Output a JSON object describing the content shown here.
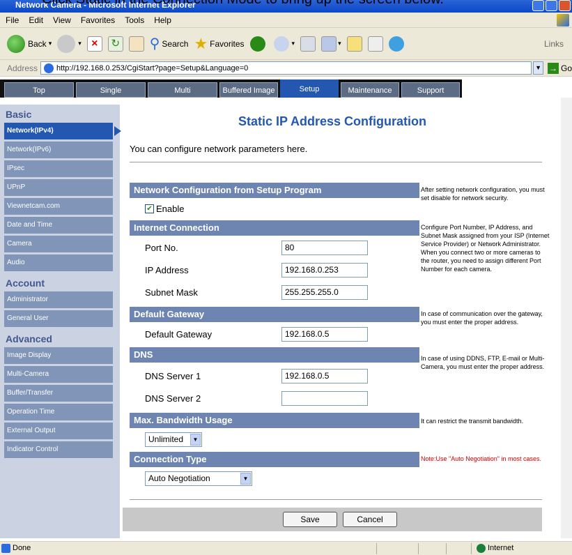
{
  "window": {
    "cut_text": "Click Static in the Connection Mode to bring up the screen below.",
    "title": "Network Camera - Microsoft Internet Explorer"
  },
  "menubar": [
    "File",
    "Edit",
    "View",
    "Favorites",
    "Tools",
    "Help"
  ],
  "toolbar": {
    "back": "Back",
    "search": "Search",
    "favorites": "Favorites",
    "links": "Links"
  },
  "address": {
    "label": "Address",
    "url": "http://192.168.0.253/CgiStart?page=Setup&Language=0",
    "go": "Go"
  },
  "topnav": [
    "Top",
    "Single",
    "Multi",
    "Buffered Image",
    "Setup",
    "Maintenance",
    "Support"
  ],
  "sidebar": {
    "basic_heading": "Basic",
    "basic_items": [
      "Network(IPv4)",
      "Network(IPv6)",
      "IPsec",
      "UPnP",
      "Viewnetcam.com",
      "Date and Time",
      "Camera",
      "Audio"
    ],
    "account_heading": "Account",
    "account_items": [
      "Administrator",
      "General User"
    ],
    "advanced_heading": "Advanced",
    "advanced_items": [
      "Image Display",
      "Multi-Camera",
      "Buffer/Transfer",
      "Operation Time",
      "External Output",
      "Indicator Control"
    ]
  },
  "main": {
    "title": "Static IP Address Configuration",
    "intro": "You can configure network parameters here.",
    "sections": {
      "setup_program": {
        "header": "Network Configuration from Setup Program",
        "enable_label": "Enable",
        "note": "After setting network configuration, you must set disable for network security."
      },
      "internet": {
        "header": "Internet Connection",
        "port_label": "Port No.",
        "port_value": "80",
        "ip_label": "IP Address",
        "ip_value": "192.168.0.253",
        "mask_label": "Subnet Mask",
        "mask_value": "255.255.255.0",
        "note": "Configure Port Number, IP Address, and Subnet Mask assigned from your ISP (Internet Service Provider) or Network Administrator. When you connect two or more cameras to the router, you need to assign different Port Number for each camera."
      },
      "gateway": {
        "header": "Default Gateway",
        "label": "Default Gateway",
        "value": "192.168.0.5",
        "note": "In case of communication over the gateway, you must enter the proper address."
      },
      "dns": {
        "header": "DNS",
        "dns1_label": "DNS Server 1",
        "dns1_value": "192.168.0.5",
        "dns2_label": "DNS Server 2",
        "dns2_value": "",
        "note": "In case of using DDNS, FTP, E-mail or Multi-Camera, you must enter the proper address."
      },
      "bandwidth": {
        "header": "Max. Bandwidth Usage",
        "value": "Unlimited",
        "note": "It can restrict the transmit bandwidth."
      },
      "connection": {
        "header": "Connection Type",
        "value": "Auto Negotiation",
        "note": "Note:Use \"Auto Negotiation\" in most cases."
      }
    },
    "save_label": "Save",
    "cancel_label": "Cancel"
  },
  "statusbar": {
    "done": "Done",
    "zone": "Internet"
  }
}
